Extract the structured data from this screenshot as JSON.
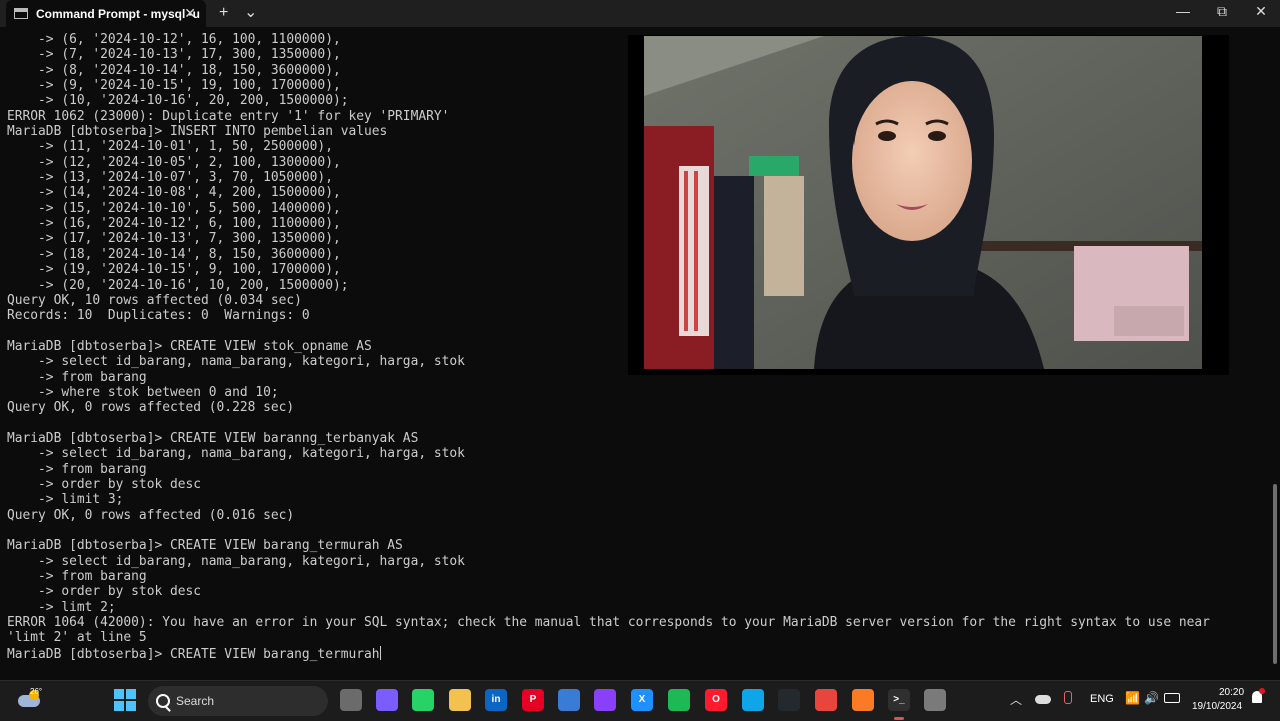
{
  "window": {
    "tab_title": "Command Prompt - mysql  -u",
    "tab_close": "✕",
    "new_tab": "+",
    "tab_dropdown": "⌄",
    "minimize": "—",
    "maximize": "⧉",
    "close": "✕"
  },
  "terminal": {
    "lines": [
      "    -> (6, '2024-10-12', 16, 100, 1100000),",
      "    -> (7, '2024-10-13', 17, 300, 1350000),",
      "    -> (8, '2024-10-14', 18, 150, 3600000),",
      "    -> (9, '2024-10-15', 19, 100, 1700000),",
      "    -> (10, '2024-10-16', 20, 200, 1500000);",
      "ERROR 1062 (23000): Duplicate entry '1' for key 'PRIMARY'",
      "MariaDB [dbtoserba]> INSERT INTO pembelian values",
      "    -> (11, '2024-10-01', 1, 50, 2500000),",
      "    -> (12, '2024-10-05', 2, 100, 1300000),",
      "    -> (13, '2024-10-07', 3, 70, 1050000),",
      "    -> (14, '2024-10-08', 4, 200, 1500000),",
      "    -> (15, '2024-10-10', 5, 500, 1400000),",
      "    -> (16, '2024-10-12', 6, 100, 1100000),",
      "    -> (17, '2024-10-13', 7, 300, 1350000),",
      "    -> (18, '2024-10-14', 8, 150, 3600000),",
      "    -> (19, '2024-10-15', 9, 100, 1700000),",
      "    -> (20, '2024-10-16', 10, 200, 1500000);",
      "Query OK, 10 rows affected (0.034 sec)",
      "Records: 10  Duplicates: 0  Warnings: 0",
      "",
      "MariaDB [dbtoserba]> CREATE VIEW stok_opname AS",
      "    -> select id_barang, nama_barang, kategori, harga, stok",
      "    -> from barang",
      "    -> where stok between 0 and 10;",
      "Query OK, 0 rows affected (0.228 sec)",
      "",
      "MariaDB [dbtoserba]> CREATE VIEW baranng_terbanyak AS",
      "    -> select id_barang, nama_barang, kategori, harga, stok",
      "    -> from barang",
      "    -> order by stok desc",
      "    -> limit 3;",
      "Query OK, 0 rows affected (0.016 sec)",
      "",
      "MariaDB [dbtoserba]> CREATE VIEW barang_termurah AS",
      "    -> select id_barang, nama_barang, kategori, harga, stok",
      "    -> from barang",
      "    -> order by stok desc",
      "    -> limt 2;",
      "ERROR 1064 (42000): You have an error in your SQL syntax; check the manual that corresponds to your MariaDB server version for the right syntax to use near",
      "'limt 2' at line 5",
      "MariaDB [dbtoserba]> CREATE VIEW barang_termurah"
    ]
  },
  "taskbar": {
    "weather_temp": "26°",
    "search_label": "Search",
    "language": "ENG",
    "time": "20:20",
    "date": "19/10/2024",
    "tray_chevron": "︿",
    "wifi": "📶",
    "volume": "🔊",
    "apps": [
      {
        "name": "file-explorer-gray",
        "color": "#6b6b6b",
        "label": ""
      },
      {
        "name": "copilot",
        "color": "#7b5cff",
        "label": ""
      },
      {
        "name": "whatsapp",
        "color": "#25d366",
        "label": ""
      },
      {
        "name": "file-explorer",
        "color": "#f2c14e",
        "label": ""
      },
      {
        "name": "linkedin",
        "color": "#0a66c2",
        "label": "in"
      },
      {
        "name": "pinterest",
        "color": "#e60023",
        "label": "P"
      },
      {
        "name": "microsoft-store",
        "color": "#3a7bd5",
        "label": ""
      },
      {
        "name": "visual-studio",
        "color": "#8a3ffc",
        "label": ""
      },
      {
        "name": "xampp-like",
        "color": "#1e90ff",
        "label": "X"
      },
      {
        "name": "spotify",
        "color": "#1db954",
        "label": ""
      },
      {
        "name": "opera",
        "color": "#ff1b2d",
        "label": "O"
      },
      {
        "name": "edge",
        "color": "#0ea5e9",
        "label": ""
      },
      {
        "name": "github",
        "color": "#24292e",
        "label": ""
      },
      {
        "name": "chrome",
        "color": "#e8453c",
        "label": ""
      },
      {
        "name": "xampp",
        "color": "#fb7a24",
        "label": ""
      },
      {
        "name": "terminal",
        "color": "#2f2f2f",
        "label": ">_"
      },
      {
        "name": "snipping-tool",
        "color": "#7a7a7a",
        "label": ""
      }
    ]
  }
}
